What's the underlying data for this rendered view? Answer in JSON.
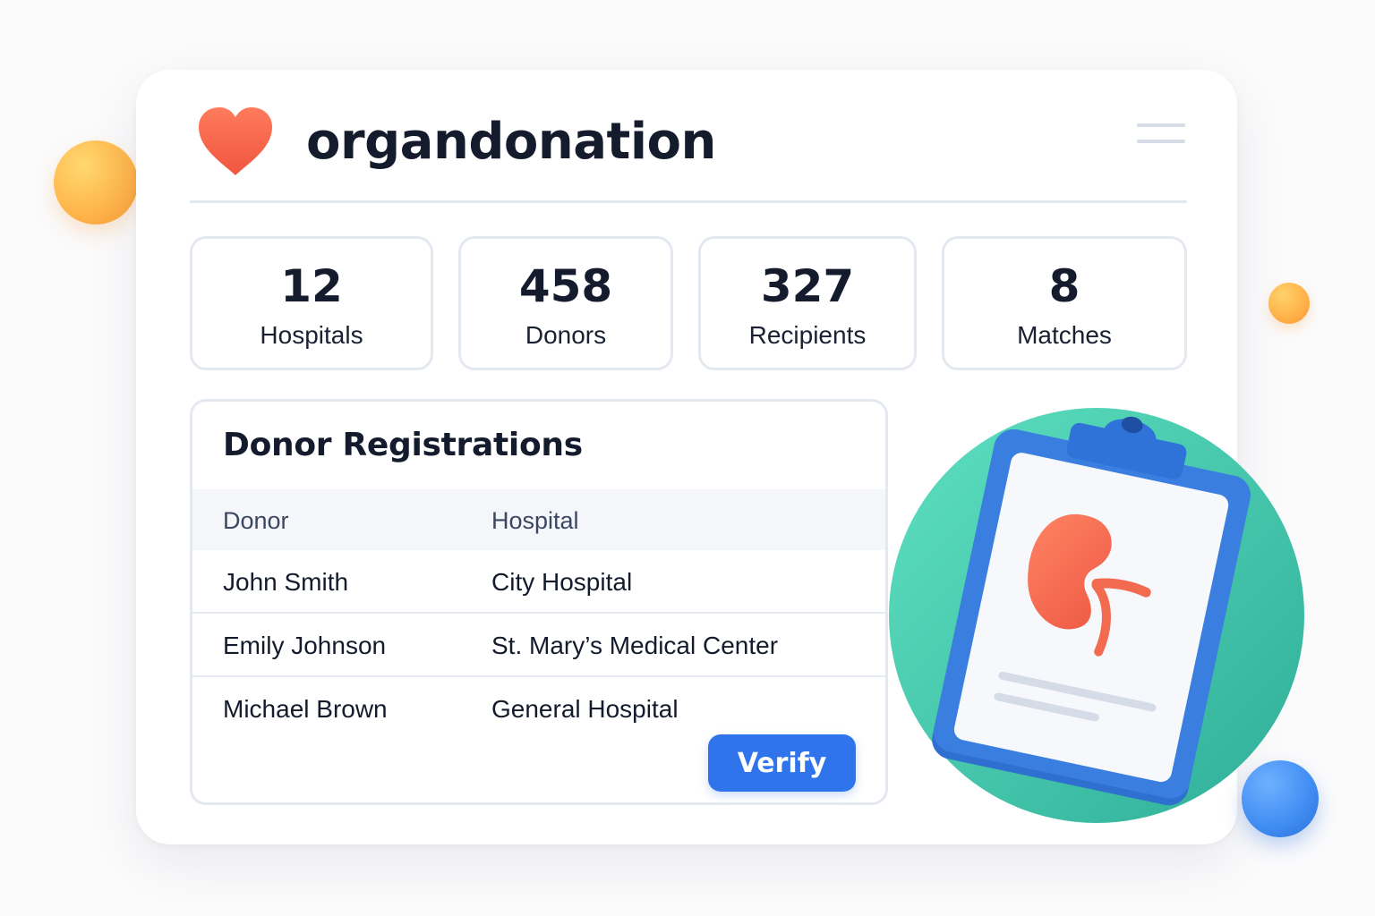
{
  "app": {
    "title": "organdonation"
  },
  "stats": [
    {
      "value": "12",
      "label": "Hospitals"
    },
    {
      "value": "458",
      "label": "Donors"
    },
    {
      "value": "327",
      "label": "Recipients"
    },
    {
      "value": "8",
      "label": "Matches"
    }
  ],
  "registrations": {
    "title": "Donor Registrations",
    "columns": [
      "Donor",
      "Hospital"
    ],
    "rows": [
      {
        "donor": "John Smith",
        "hospital": "City Hospital"
      },
      {
        "donor": "Emily Johnson",
        "hospital": "St. Mary’s Medical Center"
      },
      {
        "donor": "Michael Brown",
        "hospital": "General Hospital"
      }
    ],
    "action_label": "Verify"
  },
  "colors": {
    "accent": "#2f74eb",
    "heart": "#f26a4f",
    "kidney": "#f2684f",
    "teal": "#3cc6a8"
  },
  "icons": {
    "logo": "heart-icon",
    "menu": "menu-icon",
    "illustration": "clipboard-kidney-icon"
  }
}
